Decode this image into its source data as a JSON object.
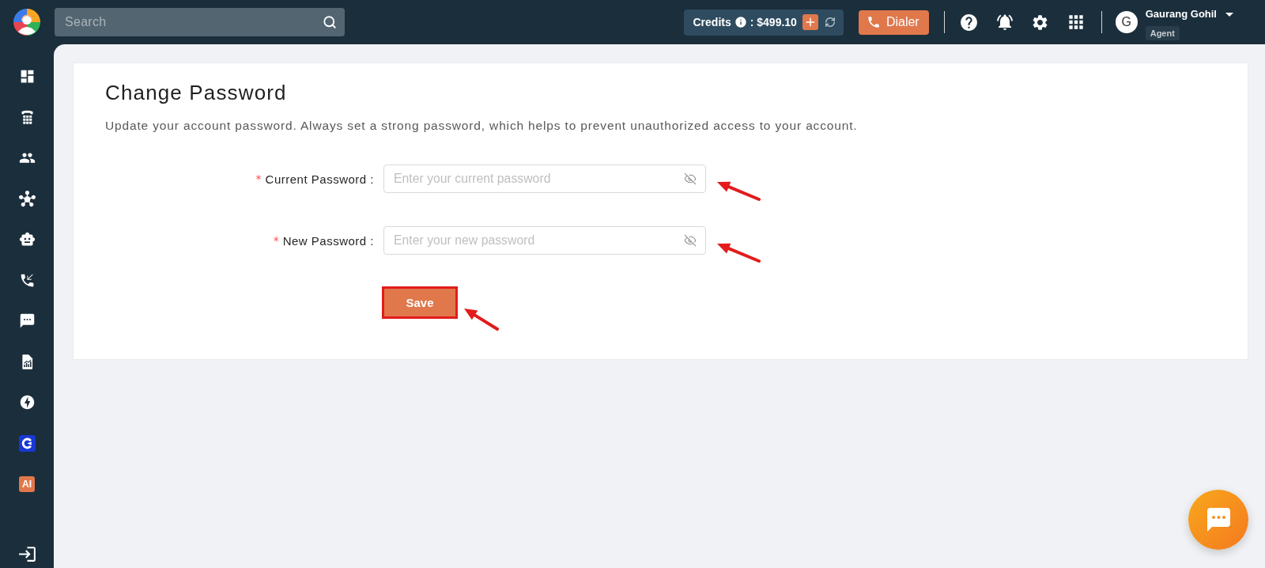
{
  "topbar": {
    "search": {
      "placeholder": "Search"
    },
    "credits": {
      "label": "Credits",
      "amount": ": $499.10"
    },
    "dialer_button": {
      "label": "Dialer"
    },
    "user": {
      "initial": "G",
      "name": "Gaurang Gohil",
      "role": "Agent"
    }
  },
  "sidebar": {
    "items": [
      {
        "kind": "icon",
        "selected": false
      },
      {
        "kind": "icon",
        "selected": false
      },
      {
        "kind": "icon",
        "selected": false
      },
      {
        "kind": "icon",
        "selected": false
      },
      {
        "kind": "icon",
        "selected": false
      },
      {
        "kind": "icon",
        "selected": false
      },
      {
        "kind": "icon",
        "selected": false
      },
      {
        "kind": "icon",
        "selected": false
      },
      {
        "kind": "icon",
        "selected": false
      },
      {
        "kind": "icon",
        "selected": false
      },
      {
        "kind": "badge",
        "label": "AI",
        "selected": false
      }
    ]
  },
  "page": {
    "title": "Change Password",
    "description": "Update your account password. Always set a strong password, which helps to prevent unauthorized access to your account.",
    "fields": [
      {
        "required_mark": "*",
        "label": "Current Password :",
        "placeholder": "Enter your current password",
        "highlighted": true
      },
      {
        "required_mark": "*",
        "label": "New Password :",
        "placeholder": "Enter your new password",
        "highlighted": true
      }
    ],
    "save_button": {
      "label": "Save",
      "highlighted": true
    }
  }
}
